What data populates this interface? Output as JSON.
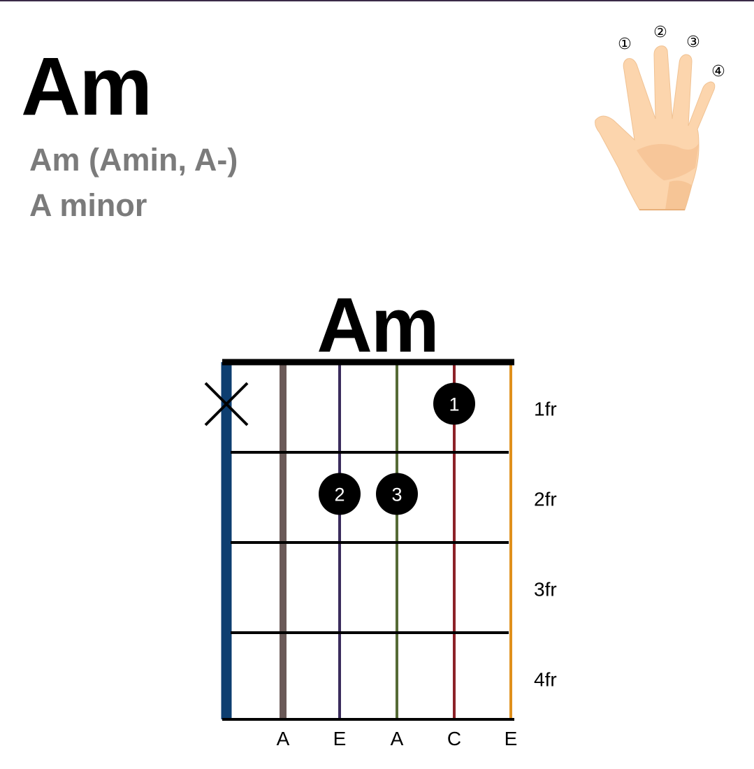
{
  "chord": {
    "name": "Am",
    "alt_names": "Am (Amin, A-)",
    "full_name": "A minor"
  },
  "hand_legend": {
    "fingers": [
      "①",
      "②",
      "③",
      "④"
    ],
    "skin_color": "#fcd5ad",
    "shadow_color": "#f4bd8c"
  },
  "diagram": {
    "title": "Am",
    "frets": [
      "1fr",
      "2fr",
      "3fr",
      "4fr"
    ],
    "strings": [
      {
        "note": "",
        "color": "#0d3e70",
        "muted": true
      },
      {
        "note": "A",
        "color": "#6b5a58",
        "muted": false
      },
      {
        "note": "E",
        "color": "#3a2c5c",
        "muted": false
      },
      {
        "note": "A",
        "color": "#566b36",
        "muted": false
      },
      {
        "note": "C",
        "color": "#8c2228",
        "muted": false
      },
      {
        "note": "E",
        "color": "#e0901c",
        "muted": false
      }
    ],
    "fingers": [
      {
        "string": 5,
        "fret": 1,
        "finger": "1"
      },
      {
        "string": 3,
        "fret": 2,
        "finger": "2"
      },
      {
        "string": 4,
        "fret": 2,
        "finger": "3"
      }
    ],
    "dot_color": "#000000"
  }
}
